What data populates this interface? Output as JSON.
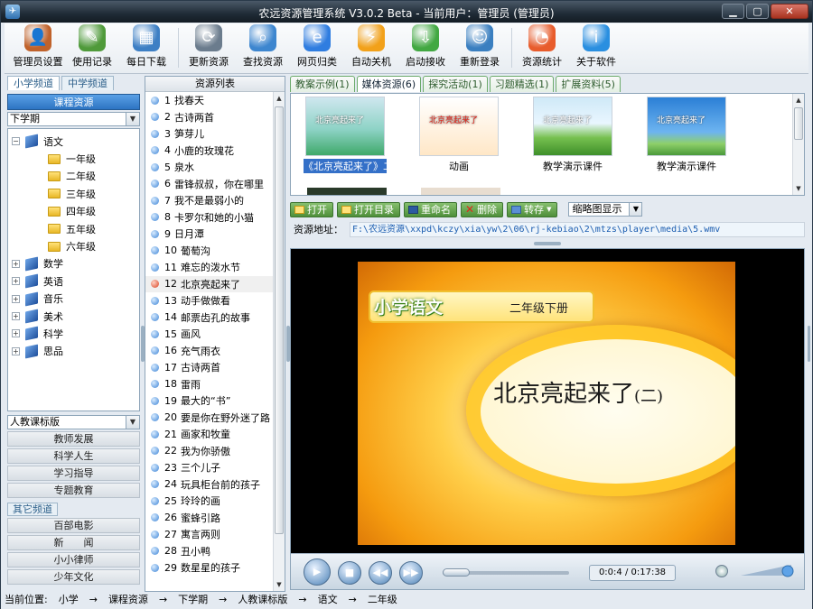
{
  "window": {
    "title": "农远资源管理系统 V3.0.2 Beta - 当前用户：管理员 (管理员)",
    "controls": [
      "minimize",
      "maximize",
      "close"
    ]
  },
  "toolbar": [
    {
      "label": "管理员设置",
      "icon": "admin-user-icon",
      "color": "#c0622b"
    },
    {
      "label": "使用记录",
      "icon": "notebook-pen-icon",
      "color": "#4f9a3a"
    },
    {
      "label": "每日下载",
      "icon": "calendar-icon",
      "color": "#3d7fc4"
    },
    {
      "label": "更新资源",
      "icon": "update-disk-icon",
      "color": "#6b7c8d"
    },
    {
      "label": "查找资源",
      "icon": "magnifier-icon",
      "color": "#3d86cf"
    },
    {
      "label": "网页归类",
      "icon": "ie-globe-icon",
      "color": "#2f7de0"
    },
    {
      "label": "自动关机",
      "icon": "runner-icon",
      "color": "#f2a11a"
    },
    {
      "label": "启动接收",
      "icon": "receive-arrow-icon",
      "color": "#42a842"
    },
    {
      "label": "重新登录",
      "icon": "users-icon",
      "color": "#3a7fc0"
    },
    {
      "label": "资源统计",
      "icon": "pie-chart-icon",
      "color": "#e85c2c"
    },
    {
      "label": "关于软件",
      "icon": "info-icon",
      "color": "#2a8fe0"
    }
  ],
  "left": {
    "tabs": [
      "小学频道",
      "中学频道"
    ],
    "panel_title": "课程资源",
    "semester": "下学期",
    "tree": [
      {
        "label": "语文",
        "expand": "−",
        "type": "book",
        "level": 0
      },
      {
        "label": "一年级",
        "type": "folder",
        "level": 1
      },
      {
        "label": "二年级",
        "type": "folder",
        "level": 1
      },
      {
        "label": "三年级",
        "type": "folder",
        "level": 1
      },
      {
        "label": "四年级",
        "type": "folder",
        "level": 1
      },
      {
        "label": "五年级",
        "type": "folder",
        "level": 1
      },
      {
        "label": "六年级",
        "type": "folder",
        "level": 1
      },
      {
        "label": "数学",
        "expand": "+",
        "type": "book",
        "level": 0
      },
      {
        "label": "英语",
        "expand": "+",
        "type": "book",
        "level": 0
      },
      {
        "label": "音乐",
        "expand": "+",
        "type": "book",
        "level": 0
      },
      {
        "label": "美术",
        "expand": "+",
        "type": "book",
        "level": 0
      },
      {
        "label": "科学",
        "expand": "+",
        "type": "book",
        "level": 0
      },
      {
        "label": "思品",
        "expand": "+",
        "type": "book",
        "level": 0
      }
    ],
    "edition": "人教课标版",
    "sections": [
      "教师发展",
      "科学人生",
      "学习指导",
      "专题教育"
    ],
    "other_header": "其它频道",
    "other": [
      "百部电影",
      "新　　闻",
      "小小律师",
      "少年文化"
    ]
  },
  "list": {
    "header": "资源列表",
    "items": [
      {
        "no": "1",
        "title": "找春天"
      },
      {
        "no": "2",
        "title": "古诗两首"
      },
      {
        "no": "3",
        "title": "笋芽儿"
      },
      {
        "no": "4",
        "title": "小鹿的玫瑰花"
      },
      {
        "no": "5",
        "title": "泉水"
      },
      {
        "no": "6",
        "title": "雷锋叔叔，你在哪里"
      },
      {
        "no": "7",
        "title": "我不是最弱小的"
      },
      {
        "no": "8",
        "title": "卡罗尔和她的小猫"
      },
      {
        "no": "9",
        "title": "日月潭"
      },
      {
        "no": "10",
        "title": "葡萄沟"
      },
      {
        "no": "11",
        "title": "难忘的泼水节"
      },
      {
        "no": "12",
        "title": "北京亮起来了",
        "selected": true
      },
      {
        "no": "13",
        "title": "动手做做看"
      },
      {
        "no": "14",
        "title": "邮票齿孔的故事"
      },
      {
        "no": "15",
        "title": "画风"
      },
      {
        "no": "16",
        "title": "充气雨衣"
      },
      {
        "no": "17",
        "title": "古诗两首"
      },
      {
        "no": "18",
        "title": "雷雨"
      },
      {
        "no": "19",
        "title": "最大的“书”"
      },
      {
        "no": "20",
        "title": "要是你在野外迷了路"
      },
      {
        "no": "21",
        "title": "画家和牧童"
      },
      {
        "no": "22",
        "title": "我为你骄傲"
      },
      {
        "no": "23",
        "title": "三个儿子"
      },
      {
        "no": "24",
        "title": "玩具柜台前的孩子"
      },
      {
        "no": "25",
        "title": "玲玲的画"
      },
      {
        "no": "26",
        "title": "蜜蜂引路"
      },
      {
        "no": "27",
        "title": "寓言两则"
      },
      {
        "no": "28",
        "title": "丑小鸭"
      },
      {
        "no": "29",
        "title": "数星星的孩子"
      }
    ]
  },
  "tabs": [
    "教案示例(1)",
    "媒体资源(6)",
    "探究活动(1)",
    "习题精选(1)",
    "扩展资料(5)"
  ],
  "thumbnails": [
    {
      "caption": "《北京亮起来了》二",
      "selected": true,
      "scene": "blue-green",
      "text": "北京亮起来了"
    },
    {
      "caption": "动画",
      "scene": "cartoon",
      "text": "北京亮起来了"
    },
    {
      "caption": "教学演示课件",
      "scene": "green-hill",
      "text": "北京亮起来了"
    },
    {
      "caption": "教学演示课件",
      "scene": "blue-sky",
      "text": "北京亮起来了"
    }
  ],
  "actions": [
    "打开",
    "打开目录",
    "重命名",
    "删除",
    "转存"
  ],
  "view_mode": "缩略图显示",
  "address_label": "资源地址：",
  "address": "F:\\农远资源\\xxpd\\kczy\\xia\\yw\\2\\06\\rj-kebiao\\2\\mtzs\\player\\media\\5.wmv",
  "video": {
    "subject": "小学语文",
    "grade": "二年级下册",
    "title": "北京亮起来了",
    "part": "(二)"
  },
  "player": {
    "time": "0:0:4 / 0:17:38",
    "progress": 0.004
  },
  "status": {
    "label": "当前位置:",
    "path": [
      "小学",
      "课程资源",
      "下学期",
      "人教课标版",
      "语文",
      "二年级"
    ],
    "sep": "→"
  }
}
